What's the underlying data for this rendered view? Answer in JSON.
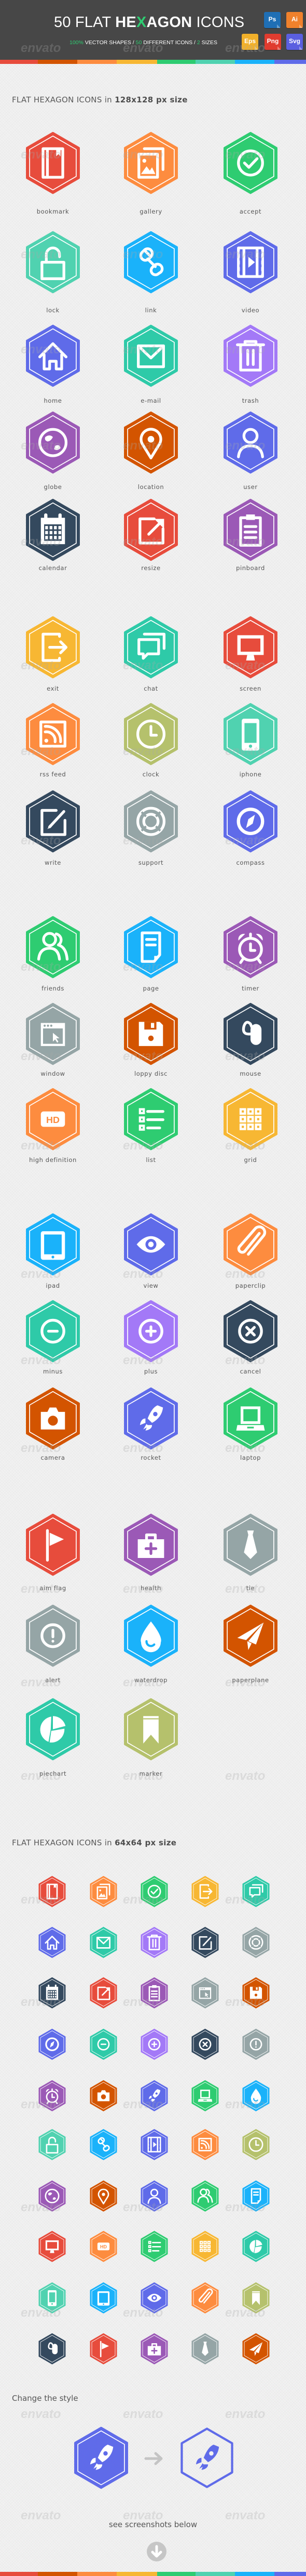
{
  "header": {
    "title_light_1": "50 FLAT ",
    "title_bold_1": "HE",
    "title_accent": "X",
    "title_bold_2": "AGON",
    "title_light_2": " ICONS",
    "subtitle": [
      {
        "text": "100%",
        "highlight": true
      },
      {
        "text": " VECTOR SHAPES / ",
        "highlight": false
      },
      {
        "text": "50",
        "highlight": true
      },
      {
        "text": " DIFFERENT ICONS / ",
        "highlight": false
      },
      {
        "text": "2",
        "highlight": true
      },
      {
        "text": " SIZES",
        "highlight": false
      }
    ],
    "accent_color": "#2ecc71",
    "background_color": "#474747",
    "badges": [
      {
        "label": "Ps",
        "color": "#1f6fb5"
      },
      {
        "label": "Ai",
        "color": "#f0812c"
      },
      {
        "label": "Eps",
        "color": "#f1b02a"
      },
      {
        "label": "Png",
        "color": "#e03c2f"
      },
      {
        "label": "Svg",
        "color": "#5a5fe0"
      }
    ]
  },
  "stripe_colors": [
    "#e74c3c",
    "#d35400",
    "#fd8c3f",
    "#f7b733",
    "#2ecc71",
    "#50d2b0",
    "#1ab2fa",
    "#5f6be9"
  ],
  "watermark_text": "envato",
  "section_large": {
    "heading_light": "FLAT HEXAGON ICONS in ",
    "heading_bold": "128x128 px size",
    "icons": [
      {
        "label": "bookmark",
        "icon": "bookmark-icon",
        "color": "#e74c3c"
      },
      {
        "label": "gallery",
        "icon": "gallery-icon",
        "color": "#fd8c3f"
      },
      {
        "label": "accept",
        "icon": "accept-icon",
        "color": "#2ecc71"
      },
      {
        "label": "lock",
        "icon": "lock-icon",
        "color": "#50d2b0"
      },
      {
        "label": "link",
        "icon": "link-icon",
        "color": "#1ab2fa"
      },
      {
        "label": "video",
        "icon": "video-icon",
        "color": "#5f6be9"
      },
      {
        "label": "home",
        "icon": "home-icon",
        "color": "#5f6be9"
      },
      {
        "label": "e-mail",
        "icon": "email-icon",
        "color": "#2ecaa8"
      },
      {
        "label": "trash",
        "icon": "trash-icon",
        "color": "#a379f7"
      },
      {
        "label": "globe",
        "icon": "globe-icon",
        "color": "#9b59b6"
      },
      {
        "label": "location",
        "icon": "location-icon",
        "color": "#d35400"
      },
      {
        "label": "user",
        "icon": "user-icon",
        "color": "#5f6be9"
      },
      {
        "label": "calendar",
        "icon": "calendar-icon",
        "color": "#34495e"
      },
      {
        "label": "resize",
        "icon": "resize-icon",
        "color": "#e74c3c"
      },
      {
        "label": "pinboard",
        "icon": "pinboard-icon",
        "color": "#9b59b6"
      },
      {
        "label": "exit",
        "icon": "exit-icon",
        "color": "#f7b733"
      },
      {
        "label": "chat",
        "icon": "chat-icon",
        "color": "#2ecaa8"
      },
      {
        "label": "screen",
        "icon": "screen-icon",
        "color": "#e74c3c"
      },
      {
        "label": "rss feed",
        "icon": "rss-icon",
        "color": "#fd8c3f"
      },
      {
        "label": "clock",
        "icon": "clock-icon",
        "color": "#b5c16c"
      },
      {
        "label": "iphone",
        "icon": "iphone-icon",
        "color": "#50d2b0"
      },
      {
        "label": "write",
        "icon": "write-icon",
        "color": "#34495e"
      },
      {
        "label": "support",
        "icon": "support-icon",
        "color": "#95a5a6"
      },
      {
        "label": "compass",
        "icon": "compass-icon",
        "color": "#5f6be9"
      },
      {
        "label": "friends",
        "icon": "friends-icon",
        "color": "#2ecc71"
      },
      {
        "label": "page",
        "icon": "page-icon",
        "color": "#1ab2fa"
      },
      {
        "label": "timer",
        "icon": "timer-icon",
        "color": "#9b59b6"
      },
      {
        "label": "window",
        "icon": "window-icon",
        "color": "#95a5a6"
      },
      {
        "label": "loppy disc",
        "icon": "floppy-disc-icon",
        "color": "#d35400"
      },
      {
        "label": "mouse",
        "icon": "mouse-icon",
        "color": "#34495e"
      },
      {
        "label": "high definition",
        "icon": "hd-icon",
        "color": "#fd8c3f"
      },
      {
        "label": "list",
        "icon": "list-icon",
        "color": "#2ecc71"
      },
      {
        "label": "grid",
        "icon": "grid-icon",
        "color": "#f7b733"
      },
      {
        "label": "ipad",
        "icon": "ipad-icon",
        "color": "#1ab2fa"
      },
      {
        "label": "view",
        "icon": "view-icon",
        "color": "#5f6be9"
      },
      {
        "label": "paperclip",
        "icon": "paperclip-icon",
        "color": "#fd8c3f"
      },
      {
        "label": "minus",
        "icon": "minus-icon",
        "color": "#2ecaa8"
      },
      {
        "label": "plus",
        "icon": "plus-icon",
        "color": "#a379f7"
      },
      {
        "label": "cancel",
        "icon": "cancel-icon",
        "color": "#34495e"
      },
      {
        "label": "camera",
        "icon": "camera-icon",
        "color": "#d35400"
      },
      {
        "label": "rocket",
        "icon": "rocket-icon",
        "color": "#5f6be9"
      },
      {
        "label": "laptop",
        "icon": "laptop-icon",
        "color": "#2ecc71"
      },
      {
        "label": "aim flag",
        "icon": "flag-icon",
        "color": "#e74c3c"
      },
      {
        "label": "health",
        "icon": "health-icon",
        "color": "#9b59b6"
      },
      {
        "label": "tie",
        "icon": "tie-icon",
        "color": "#95a5a6"
      },
      {
        "label": "alert",
        "icon": "alert-icon",
        "color": "#95a5a6"
      },
      {
        "label": "waterdrop",
        "icon": "waterdrop-icon",
        "color": "#1ab2fa"
      },
      {
        "label": "paperplane",
        "icon": "paperplane-icon",
        "color": "#d35400"
      },
      {
        "label": "piechart",
        "icon": "piechart-icon",
        "color": "#2ecaa8"
      },
      {
        "label": "marker",
        "icon": "marker-icon",
        "color": "#b5c16c"
      }
    ]
  },
  "section_small": {
    "heading_light": "FLAT HEXAGON ICONS in ",
    "heading_bold": "64x64 px size",
    "icons": [
      {
        "icon": "bookmark-icon",
        "color": "#e74c3c"
      },
      {
        "icon": "gallery-icon",
        "color": "#fd8c3f"
      },
      {
        "icon": "accept-icon",
        "color": "#2ecc71"
      },
      {
        "icon": "exit-icon",
        "color": "#f7b733"
      },
      {
        "icon": "chat-icon",
        "color": "#2ecaa8"
      },
      {
        "icon": "home-icon",
        "color": "#5f6be9"
      },
      {
        "icon": "email-icon",
        "color": "#2ecaa8"
      },
      {
        "icon": "trash-icon",
        "color": "#a379f7"
      },
      {
        "icon": "write-icon",
        "color": "#34495e"
      },
      {
        "icon": "support-icon",
        "color": "#95a5a6"
      },
      {
        "icon": "calendar-icon",
        "color": "#34495e"
      },
      {
        "icon": "resize-icon",
        "color": "#e74c3c"
      },
      {
        "icon": "pinboard-icon",
        "color": "#9b59b6"
      },
      {
        "icon": "window-icon",
        "color": "#95a5a6"
      },
      {
        "icon": "floppy-disc-icon",
        "color": "#d35400"
      },
      {
        "icon": "compass-icon",
        "color": "#5f6be9"
      },
      {
        "icon": "minus-icon",
        "color": "#2ecaa8"
      },
      {
        "icon": "plus-icon",
        "color": "#a379f7"
      },
      {
        "icon": "cancel-icon",
        "color": "#34495e"
      },
      {
        "icon": "alert-icon",
        "color": "#95a5a6"
      },
      {
        "icon": "timer-icon",
        "color": "#9b59b6"
      },
      {
        "icon": "camera-icon",
        "color": "#d35400"
      },
      {
        "icon": "rocket-icon",
        "color": "#5f6be9"
      },
      {
        "icon": "laptop-icon",
        "color": "#2ecc71"
      },
      {
        "icon": "waterdrop-icon",
        "color": "#1ab2fa"
      },
      {
        "icon": "lock-icon",
        "color": "#50d2b0"
      },
      {
        "icon": "link-icon",
        "color": "#1ab2fa"
      },
      {
        "icon": "video-icon",
        "color": "#5f6be9"
      },
      {
        "icon": "rss-icon",
        "color": "#fd8c3f"
      },
      {
        "icon": "clock-icon",
        "color": "#b5c16c"
      },
      {
        "icon": "globe-icon",
        "color": "#9b59b6"
      },
      {
        "icon": "location-icon",
        "color": "#d35400"
      },
      {
        "icon": "user-icon",
        "color": "#5f6be9"
      },
      {
        "icon": "friends-icon",
        "color": "#2ecc71"
      },
      {
        "icon": "page-icon",
        "color": "#1ab2fa"
      },
      {
        "icon": "screen-icon",
        "color": "#e74c3c"
      },
      {
        "icon": "hd-icon",
        "color": "#fd8c3f"
      },
      {
        "icon": "list-icon",
        "color": "#2ecc71"
      },
      {
        "icon": "grid-icon",
        "color": "#f7b733"
      },
      {
        "icon": "piechart-icon",
        "color": "#2ecaa8"
      },
      {
        "icon": "iphone-icon",
        "color": "#50d2b0"
      },
      {
        "icon": "ipad-icon",
        "color": "#1ab2fa"
      },
      {
        "icon": "view-icon",
        "color": "#5f6be9"
      },
      {
        "icon": "paperclip-icon",
        "color": "#fd8c3f"
      },
      {
        "icon": "marker-icon",
        "color": "#b5c16c"
      },
      {
        "icon": "mouse-icon",
        "color": "#34495e"
      },
      {
        "icon": "flag-icon",
        "color": "#e74c3c"
      },
      {
        "icon": "health-icon",
        "color": "#9b59b6"
      },
      {
        "icon": "tie-icon",
        "color": "#95a5a6"
      },
      {
        "icon": "paperplane-icon",
        "color": "#d35400"
      }
    ]
  },
  "style_section": {
    "heading": "Change the style",
    "before": {
      "icon": "rocket-icon",
      "style": "filled",
      "color": "#5f6be9"
    },
    "after": {
      "icon": "rocket-icon",
      "style": "outline",
      "color": "#5f6be9"
    },
    "arrow_icon": "arrow-right-icon",
    "footer_text": "see screenshots below",
    "down_icon": "arrow-down-circle-icon"
  }
}
